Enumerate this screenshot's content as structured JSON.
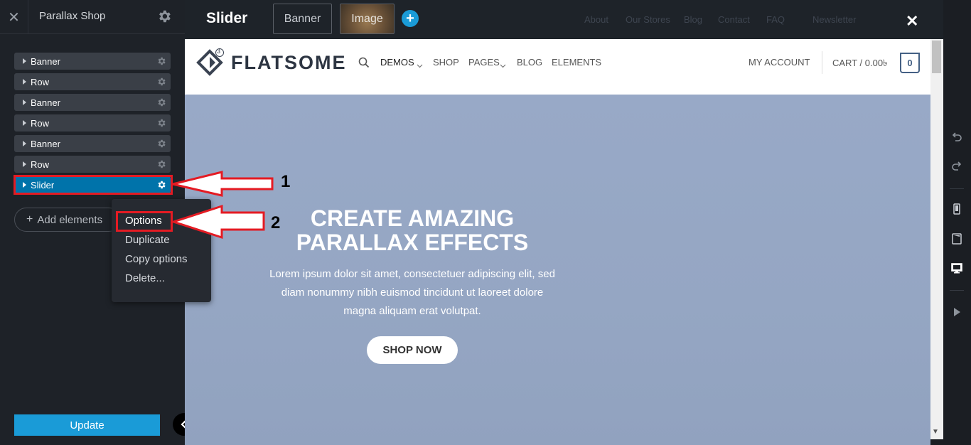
{
  "sidebar": {
    "title": "Parallax Shop",
    "items": [
      {
        "label": "Banner"
      },
      {
        "label": "Row"
      },
      {
        "label": "Banner"
      },
      {
        "label": "Row"
      },
      {
        "label": "Banner"
      },
      {
        "label": "Row"
      },
      {
        "label": "Slider"
      }
    ],
    "add_elements": "Add elements",
    "update": "Update"
  },
  "context_menu": {
    "items": [
      "Options",
      "Duplicate",
      "Copy options",
      "Delete..."
    ]
  },
  "annotations": {
    "step1": "1",
    "step2": "2"
  },
  "topbar": {
    "title": "Slider",
    "tabs": [
      "Banner",
      "Image"
    ],
    "faded_nav": [
      "About",
      "Our Stores",
      "Blog",
      "Contact",
      "FAQ",
      "Newsletter"
    ]
  },
  "site": {
    "logo_text": "FLATSOME",
    "logo_badge": "3",
    "nav": [
      "DEMOS",
      "SHOP",
      "PAGES",
      "BLOG",
      "ELEMENTS"
    ],
    "account": "MY ACCOUNT",
    "cart": "CART / 0.00৳",
    "cart_count": "0",
    "hero": {
      "title_line1": "CREATE AMAZING",
      "title_line2": "PARALLAX EFFECTS",
      "text_line1": "Lorem ipsum dolor sit amet, consectetuer adipiscing elit, sed",
      "text_line2": "diam nonummy nibh euismod tincidunt ut laoreet dolore",
      "text_line3": "magna aliquam erat volutpat.",
      "button": "SHOP NOW"
    }
  },
  "colors": {
    "accent": "#1a9bd7",
    "selected": "#0073aa",
    "annotation_red": "#e41b23",
    "hero_bg": "#96a7c4"
  }
}
